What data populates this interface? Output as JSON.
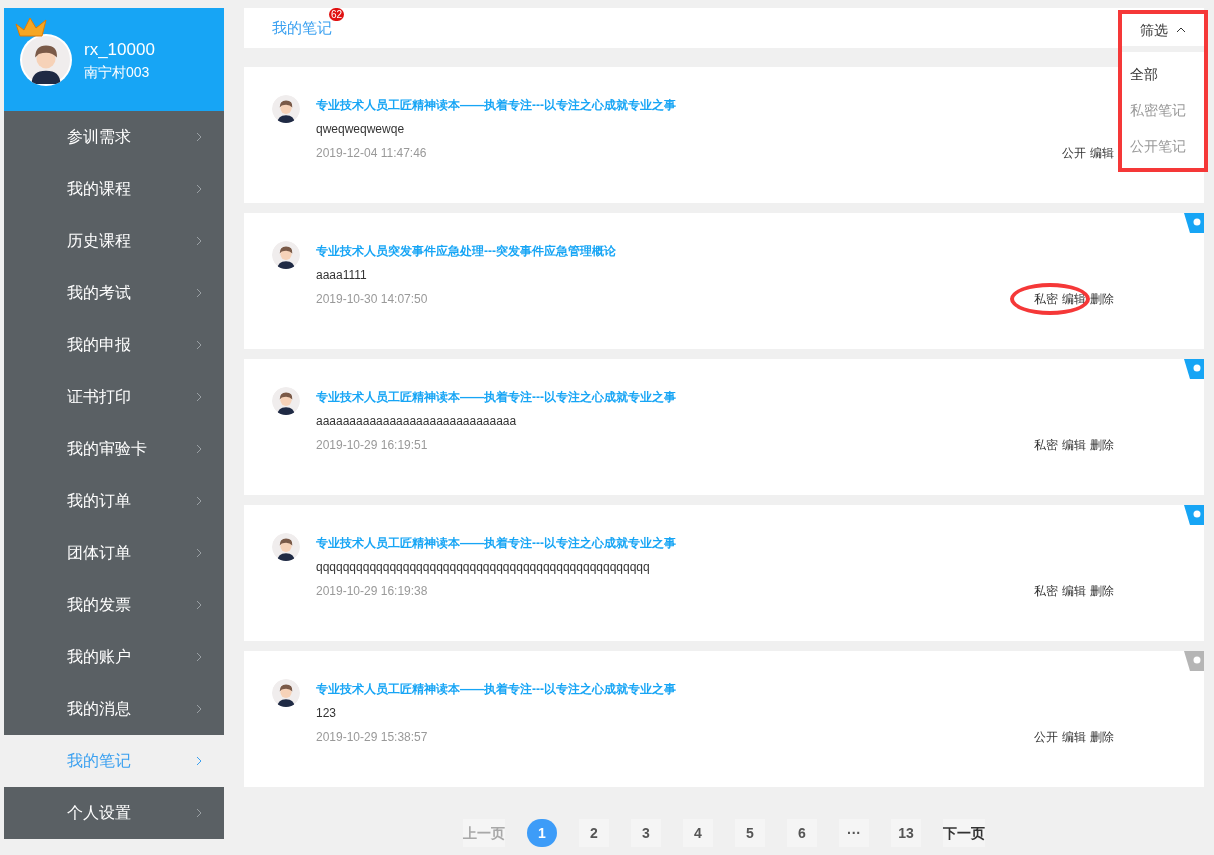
{
  "profile": {
    "username": "rx_10000",
    "org": "南宁村003"
  },
  "menu": [
    {
      "label": "参训需求",
      "selected": false
    },
    {
      "label": "我的课程",
      "selected": false
    },
    {
      "label": "历史课程",
      "selected": false
    },
    {
      "label": "我的考试",
      "selected": false
    },
    {
      "label": "我的申报",
      "selected": false
    },
    {
      "label": "证书打印",
      "selected": false
    },
    {
      "label": "我的审验卡",
      "selected": false
    },
    {
      "label": "我的订单",
      "selected": false
    },
    {
      "label": "团体订单",
      "selected": false
    },
    {
      "label": "我的发票",
      "selected": false
    },
    {
      "label": "我的账户",
      "selected": false
    },
    {
      "label": "我的消息",
      "selected": false
    },
    {
      "label": "我的笔记",
      "selected": true
    },
    {
      "label": "个人设置",
      "selected": false
    }
  ],
  "header": {
    "title": "我的笔记",
    "count": "62",
    "filter": {
      "label": "筛选",
      "expanded": true,
      "options": [
        {
          "label": "全部",
          "selected": true
        },
        {
          "label": "私密笔记",
          "selected": false
        },
        {
          "label": "公开笔记",
          "selected": false
        }
      ]
    }
  },
  "notes": [
    {
      "course": "专业技术人员工匠精神读本——执着专注---以专注之心成就专业之事",
      "content": "qweqweqwewqe",
      "time": "2019-12-04 11:47:46",
      "actions": [
        "公开",
        "编辑"
      ]
    },
    {
      "course": "专业技术人员突发事件应急处理---突发事件应急管理概论",
      "content": "aaaa1111",
      "time": "2019-10-30 14:07:50",
      "actions": [
        "私密",
        "编辑",
        "删除"
      ],
      "private": true
    },
    {
      "course": "专业技术人员工匠精神读本——执着专注---以专注之心成就专业之事",
      "content": "aaaaaaaaaaaaaaaaaaaaaaaaaaaaaa",
      "time": "2019-10-29 16:19:51",
      "actions": [
        "私密",
        "编辑",
        "删除"
      ],
      "private": true
    },
    {
      "course": "专业技术人员工匠精神读本——执着专注---以专注之心成就专业之事",
      "content": "qqqqqqqqqqqqqqqqqqqqqqqqqqqqqqqqqqqqqqqqqqqqqqqqqq",
      "time": "2019-10-29 16:19:38",
      "actions": [
        "私密",
        "编辑",
        "删除"
      ],
      "private": true
    },
    {
      "course": "专业技术人员工匠精神读本——执着专注---以专注之心成就专业之事",
      "content": "123",
      "time": "2019-10-29 15:38:57",
      "actions": [
        "公开",
        "编辑",
        "删除"
      ],
      "private": false
    }
  ],
  "pagination": {
    "prev": {
      "label": "上一页",
      "disabled": true
    },
    "pages": [
      {
        "label": "1",
        "selected": true
      },
      {
        "label": "2",
        "selected": false
      },
      {
        "label": "3",
        "selected": false
      },
      {
        "label": "4",
        "selected": false
      },
      {
        "label": "5",
        "selected": false
      },
      {
        "label": "6",
        "selected": false
      },
      {
        "label": "···",
        "selected": false
      },
      {
        "label": "13",
        "selected": false
      }
    ],
    "next": {
      "label": "下一页",
      "disabled": false
    }
  }
}
